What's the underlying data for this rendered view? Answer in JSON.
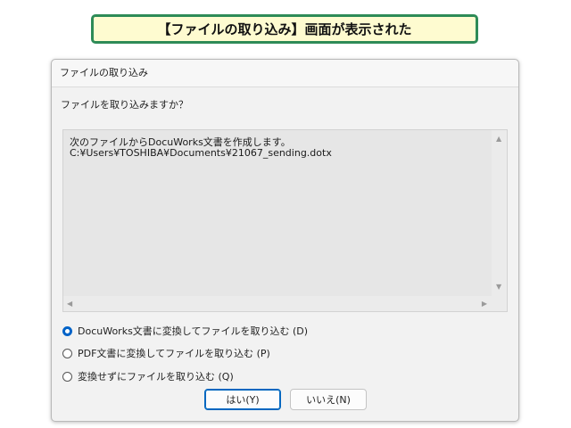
{
  "banner": {
    "text": "【ファイルの取り込み】画面が表示された"
  },
  "dialog": {
    "title": "ファイルの取り込み",
    "question": "ファイルを取り込みますか？",
    "message_lines": [
      "次のファイルからDocuWorks文書を作成します。",
      "C:¥Users¥TOSHIBA¥Documents¥21067_sending.dotx"
    ],
    "options": [
      {
        "label": "DocuWorks文書に変換してファイルを取り込む (D)",
        "checked": true
      },
      {
        "label": "PDF文書に変換してファイルを取り込む (P)",
        "checked": false
      },
      {
        "label": "変換せずにファイルを取り込む (Q)",
        "checked": false
      }
    ],
    "buttons": {
      "yes": "はい(Y)",
      "no": "いいえ(N)"
    },
    "scroll_icons": {
      "up": "▲",
      "down": "▼",
      "left": "◀",
      "right": "▶"
    }
  },
  "colors": {
    "banner_bg": "#fefbd0",
    "banner_border": "#2e8b57",
    "accent": "#0063c8"
  }
}
